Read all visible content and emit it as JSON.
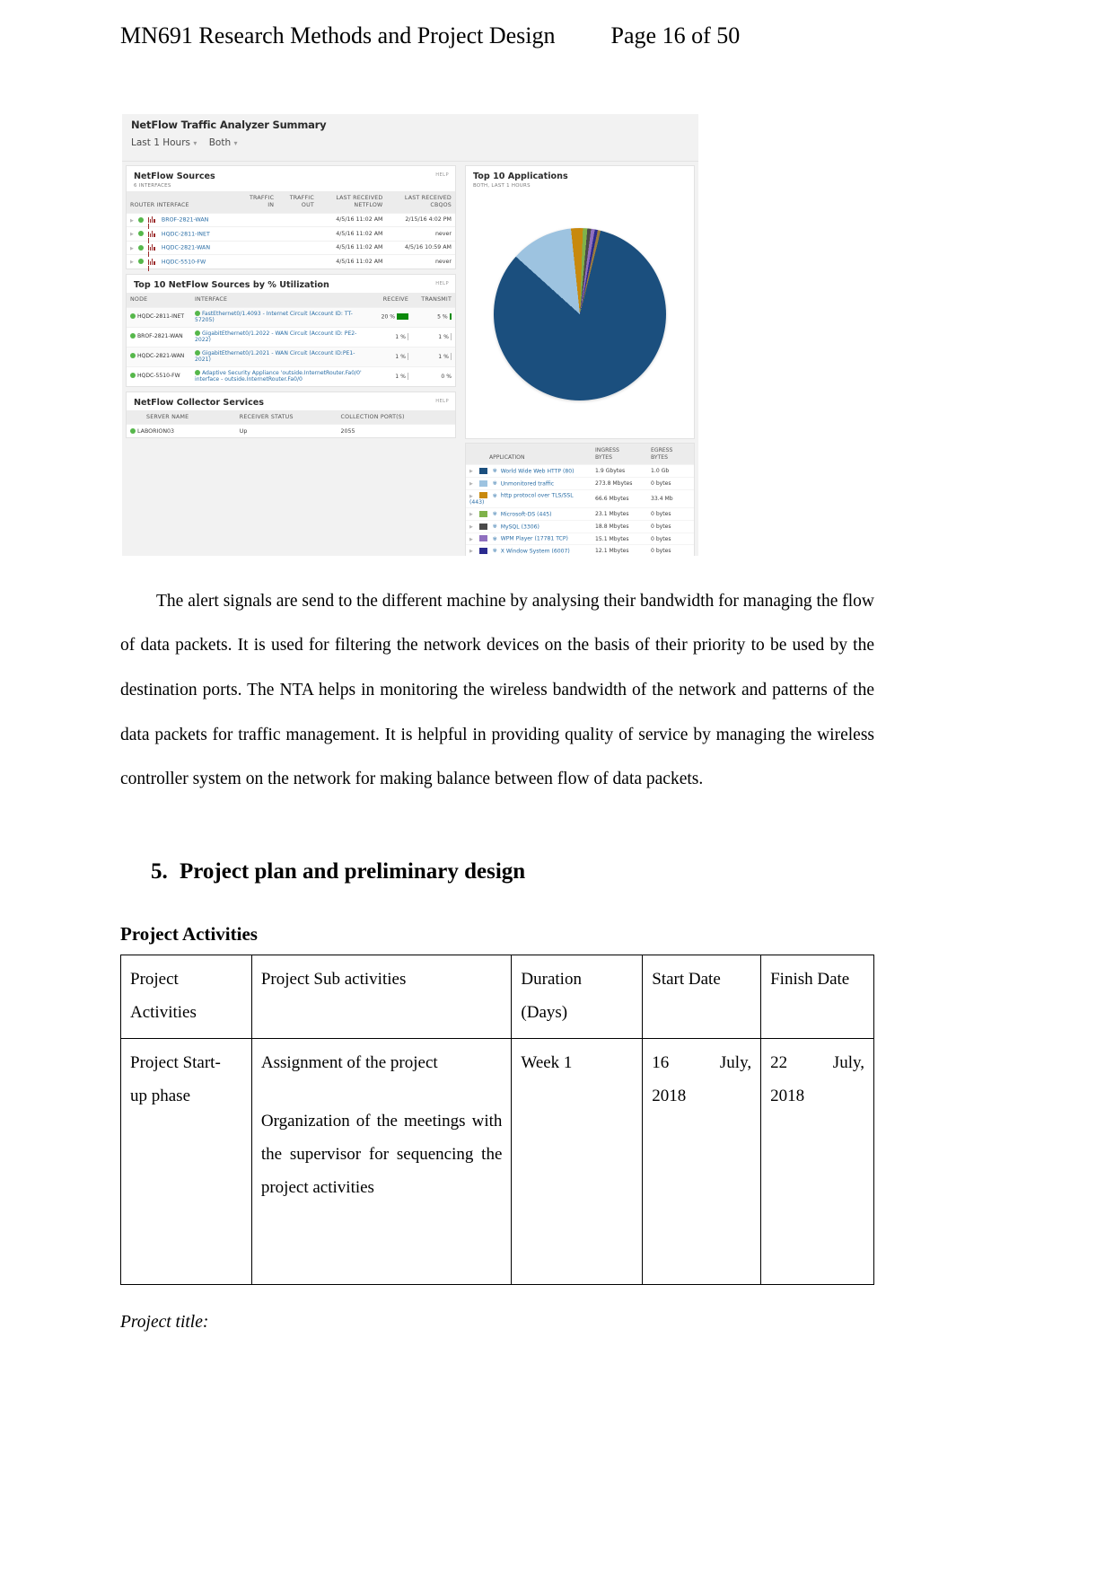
{
  "header": {
    "title": "MN691 Research Methods and Project Design",
    "page_label": "Page 16 of 50"
  },
  "figure": {
    "app_title": "NetFlow Traffic Analyzer Summary",
    "filters": {
      "time_range": "Last 1 Hours",
      "direction": "Both"
    },
    "help_label": "HELP",
    "netflow_sources": {
      "title": "NetFlow Sources",
      "subtitle": "6 INTERFACES",
      "columns": [
        "ROUTER INTERFACE",
        "TRAFFIC IN",
        "TRAFFIC OUT",
        "LAST RECEIVED NETFLOW",
        "LAST RECEIVED CBQOS"
      ],
      "columns_split": [
        {
          "l1": "ROUTER INTERFACE",
          "l2": ""
        },
        {
          "l1": "TRAFFIC",
          "l2": "IN"
        },
        {
          "l1": "TRAFFIC",
          "l2": "OUT"
        },
        {
          "l1": "LAST RECEIVED",
          "l2": "NETFLOW"
        },
        {
          "l1": "LAST RECEIVED",
          "l2": "CBQOS"
        }
      ],
      "rows": [
        {
          "name": "BROF-2821-WAN",
          "traffic_in": "",
          "traffic_out": "",
          "last_netflow": "4/5/16 11:02 AM",
          "last_cbqos": "2/15/16 4:02 PM"
        },
        {
          "name": "HQDC-2811-INET",
          "traffic_in": "",
          "traffic_out": "",
          "last_netflow": "4/5/16 11:02 AM",
          "last_cbqos": "never"
        },
        {
          "name": "HQDC-2821-WAN",
          "traffic_in": "",
          "traffic_out": "",
          "last_netflow": "4/5/16 11:02 AM",
          "last_cbqos": "4/5/16 10:59 AM"
        },
        {
          "name": "HQDC-5510-FW",
          "traffic_in": "",
          "traffic_out": "",
          "last_netflow": "4/5/16 11:02 AM",
          "last_cbqos": "never"
        }
      ]
    },
    "top_sources": {
      "title": "Top 10 NetFlow Sources by % Utilization",
      "columns": [
        "NODE",
        "INTERFACE",
        "RECEIVE",
        "TRANSMIT"
      ],
      "rows": [
        {
          "node": "HQDC-2811-INET",
          "interface": "FastEthernet0/1.4093 - Internet Circuit (Account ID: TT-57205)",
          "receive": "20 %",
          "transmit": "5 %"
        },
        {
          "node": "BROF-2821-WAN",
          "interface": "GigabitEthernet0/1.2022 - WAN Circuit (Account ID: PE2-2022)",
          "receive": "1 %",
          "transmit": "1 %"
        },
        {
          "node": "HQDC-2821-WAN",
          "interface": "GigabitEthernet0/1.2021 - WAN Circuit (Account ID:PE1-2021)",
          "receive": "1 %",
          "transmit": "1 %"
        },
        {
          "node": "HQDC-5510-FW",
          "interface": "Adaptive Security Appliance 'outside.InternetRouter.Fa0/0' interface - outside.InternetRouter.Fa0/0",
          "receive": "1 %",
          "transmit": "0 %"
        }
      ]
    },
    "collector_services": {
      "title": "NetFlow Collector Services",
      "columns": [
        "SERVER NAME",
        "RECEIVER STATUS",
        "COLLECTION PORT(S)"
      ],
      "rows": [
        {
          "server": "LABORION03",
          "status": "Up",
          "ports": "2055"
        }
      ]
    },
    "top_applications": {
      "title": "Top 10 Applications",
      "subtitle": "BOTH, LAST 1 HOURS",
      "columns_split": [
        {
          "l1": "APPLICATION",
          "l2": ""
        },
        {
          "l1": "INGRESS",
          "l2": "BYTES"
        },
        {
          "l1": "EGRESS",
          "l2": "BYTES"
        }
      ],
      "rows": [
        {
          "name": "World Wide Web HTTP (80)",
          "color": "#1b4f7e",
          "ingress": "1.9 Gbytes",
          "egress": "1.0 Gb"
        },
        {
          "name": "Unmonitored traffic",
          "color": "#9dc3e0",
          "ingress": "273.8 Mbytes",
          "egress": "0 bytes"
        },
        {
          "name": "http protocol over TLS/SSL (443)",
          "color": "#c8890d",
          "ingress": "66.6 Mbytes",
          "egress": "33.4 Mb"
        },
        {
          "name": "Microsoft-DS (445)",
          "color": "#7fb24a",
          "ingress": "23.1 Mbytes",
          "egress": "0 bytes"
        },
        {
          "name": "MySQL (3306)",
          "color": "#4a4a4a",
          "ingress": "18.8 Mbytes",
          "egress": "0 bytes"
        },
        {
          "name": "WPM Player (17781 TCP)",
          "color": "#8f6fbf",
          "ingress": "15.1 Mbytes",
          "egress": "0 bytes"
        },
        {
          "name": "X Window System (6007)",
          "color": "#2b2b8f",
          "ingress": "12.1 Mbytes",
          "egress": "0 bytes"
        }
      ]
    }
  },
  "chart_data": {
    "type": "pie",
    "title": "Top 10 Applications",
    "subtitle": "BOTH, LAST 1 HOURS",
    "legend_position": "below",
    "categories": [
      "World Wide Web HTTP (80)",
      "Unmonitored traffic",
      "http protocol over TLS/SSL (443)",
      "Microsoft-DS (445)",
      "MySQL (3306)",
      "WPM Player (17781 TCP)",
      "X Window System (6007)"
    ],
    "values": [
      1900,
      273.8,
      66.6,
      23.1,
      18.8,
      15.1,
      12.1
    ],
    "unit": "Mbytes ingress",
    "colors": [
      "#1b4f7e",
      "#9dc3e0",
      "#c8890d",
      "#7fb24a",
      "#4a4a4a",
      "#8f6fbf",
      "#2b2b8f"
    ]
  },
  "body": {
    "paragraph": "The alert signals are send to the different machine by analysing their bandwidth for managing the flow of data packets. It is used for filtering the network devices on the basis of their priority to be used by the destination ports. The NTA helps in monitoring the wireless bandwidth of the network and patterns of the data packets for traffic management. It is helpful in providing quality of service by managing the wireless controller system on the network for making balance between flow of data packets."
  },
  "section": {
    "number": "5.",
    "heading": "Project plan and preliminary design",
    "subheading": "Project Activities"
  },
  "activities_table": {
    "headers": {
      "c1_l1": "Project",
      "c1_l2": "Activities",
      "c2": "Project Sub activities",
      "c3_l1": "Duration",
      "c3_l2": "(Days)",
      "c4": "Start Date",
      "c5": "Finish Date"
    },
    "rows": [
      {
        "activity_l1": "Project  Start-",
        "activity_l2": "up phase",
        "sub_1": "Assignment of the project",
        "sub_2": "Organization of the meetings with the supervisor for sequencing the project activities",
        "duration": "Week 1",
        "start_date_l1": "16",
        "start_date_l1b": "July,",
        "start_date_l2": "2018",
        "finish_date_l1": "22",
        "finish_date_l1b": "July,",
        "finish_date_l2": "2018"
      }
    ]
  },
  "footer": {
    "project_title_label": "Project title:"
  }
}
